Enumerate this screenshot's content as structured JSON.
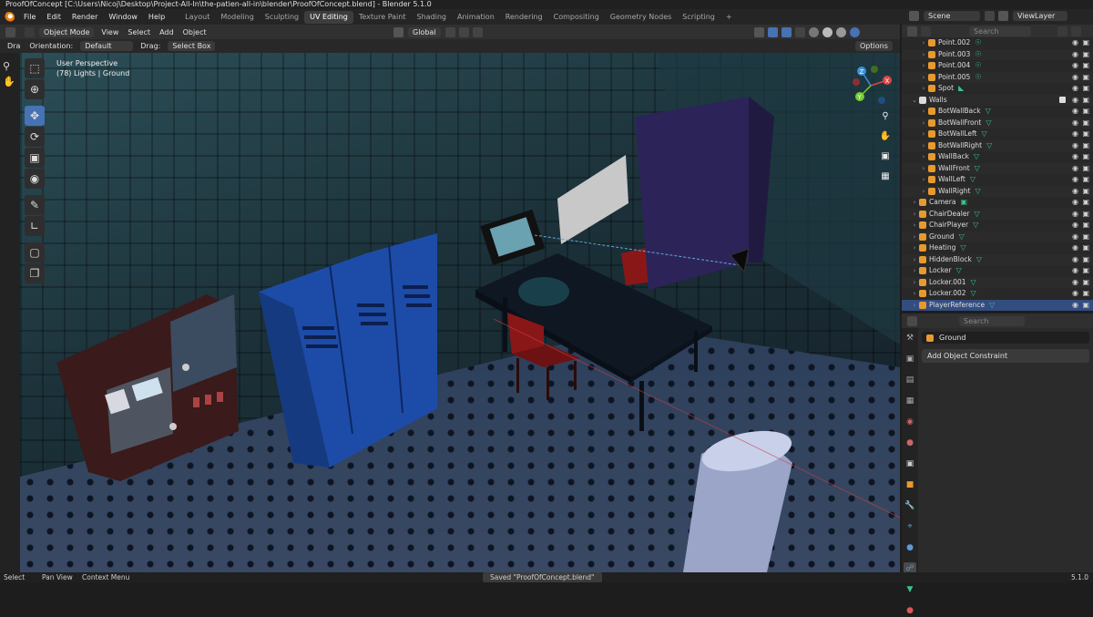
{
  "title_bar": "ProofOfConcept [C:\\Users\\Nicoj\\Desktop\\Project-All-In\\the-patien-all-in\\blender\\ProofOfConcept.blend] - Blender 5.1.0",
  "menus": [
    "File",
    "Edit",
    "Render",
    "Window",
    "Help"
  ],
  "workspaces": [
    "Layout",
    "Modeling",
    "Sculpting",
    "UV Editing",
    "Texture Paint",
    "Shading",
    "Animation",
    "Rendering",
    "Compositing",
    "Geometry Nodes",
    "Scripting"
  ],
  "active_workspace_index": 3,
  "add_workspace": "+",
  "scene": "Scene",
  "view_layer": "ViewLayer",
  "viewport_header": {
    "mode": "Object Mode",
    "view": "View",
    "select": "Select",
    "add": "Add",
    "object": "Object",
    "transform": "Global"
  },
  "tool_header": {
    "drag_prefix": "Dra",
    "orientation_label": "Orientation:",
    "orientation_value": "Default",
    "drag_label": "Drag:",
    "drag_value": "Select Box",
    "options": "Options"
  },
  "viewport_info": {
    "line1": "User Perspective",
    "line2": "(78) Lights | Ground"
  },
  "gizmo": {
    "x": "X",
    "y": "Y",
    "z": "Z"
  },
  "outliner": {
    "search_placeholder": "Search",
    "rows": [
      {
        "name": "Point.002",
        "indent": 2,
        "icon": "light",
        "mod": "light-data"
      },
      {
        "name": "Point.003",
        "indent": 2,
        "icon": "light",
        "mod": "light-data"
      },
      {
        "name": "Point.004",
        "indent": 2,
        "icon": "light",
        "mod": "light-data"
      },
      {
        "name": "Point.005",
        "indent": 2,
        "icon": "light",
        "mod": "light-data"
      },
      {
        "name": "Spot",
        "indent": 2,
        "icon": "light",
        "mod": "spot-data"
      },
      {
        "name": "Walls",
        "indent": 1,
        "icon": "collection",
        "mod": "",
        "expanded": true,
        "checkbox": true
      },
      {
        "name": "BotWallBack",
        "indent": 2,
        "icon": "mesh",
        "mod": "mesh-data"
      },
      {
        "name": "BotWallFront",
        "indent": 2,
        "icon": "mesh",
        "mod": "mesh-data"
      },
      {
        "name": "BotWallLeft",
        "indent": 2,
        "icon": "mesh",
        "mod": "mesh-data"
      },
      {
        "name": "BotWallRight",
        "indent": 2,
        "icon": "mesh",
        "mod": "mesh-data"
      },
      {
        "name": "WallBack",
        "indent": 2,
        "icon": "mesh",
        "mod": "mesh-data"
      },
      {
        "name": "WallFront",
        "indent": 2,
        "icon": "mesh",
        "mod": "mesh-data"
      },
      {
        "name": "WallLeft",
        "indent": 2,
        "icon": "mesh",
        "mod": "mesh-data"
      },
      {
        "name": "WallRight",
        "indent": 2,
        "icon": "mesh",
        "mod": "mesh-data"
      },
      {
        "name": "Camera",
        "indent": 1,
        "icon": "camera",
        "mod": "camera-data"
      },
      {
        "name": "ChairDealer",
        "indent": 1,
        "icon": "mesh",
        "mod": "mesh-data"
      },
      {
        "name": "ChairPlayer",
        "indent": 1,
        "icon": "mesh",
        "mod": "mesh-data"
      },
      {
        "name": "Ground",
        "indent": 1,
        "icon": "mesh",
        "mod": "mesh-data"
      },
      {
        "name": "Heating",
        "indent": 1,
        "icon": "mesh",
        "mod": "mesh-data"
      },
      {
        "name": "HiddenBlock",
        "indent": 1,
        "icon": "mesh",
        "mod": "mesh-data"
      },
      {
        "name": "Locker",
        "indent": 1,
        "icon": "mesh",
        "mod": "mesh-data"
      },
      {
        "name": "Locker.001",
        "indent": 1,
        "icon": "mesh",
        "mod": "mesh-data"
      },
      {
        "name": "Locker.002",
        "indent": 1,
        "icon": "mesh",
        "mod": "mesh-data"
      },
      {
        "name": "PlayerReference",
        "indent": 1,
        "icon": "mesh",
        "mod": "mesh-data",
        "selected": true
      }
    ]
  },
  "properties": {
    "search_placeholder": "Search",
    "object_name": "Ground",
    "add_constraint": "Add Object Constraint"
  },
  "status_bar": {
    "select": "Select",
    "pan": "Pan View",
    "context": "Context Menu",
    "notification": "Saved \"ProofOfConcept.blend\"",
    "version": "5.1.0"
  }
}
